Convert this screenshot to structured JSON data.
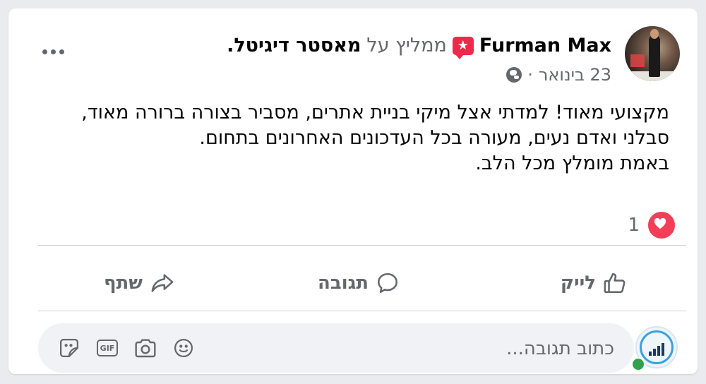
{
  "post": {
    "author_name": "Furman Max",
    "recommends_label": "ממליץ על",
    "page_name": "מאסטר דיגיטל",
    "trailing_period": ".",
    "date": "23 בינואר",
    "separator": "·",
    "body_lines": [
      "מקצועי מאוד! למדתי אצל מיקי בניית אתרים, מסביר בצורה ברורה מאוד,",
      "סבלני ואדם נעים, מעורה בכל העדכונים האחרונים בתחום.",
      "באמת מומלץ מכל הלב."
    ],
    "reaction_count": "1"
  },
  "actions": {
    "like_label": "לייק",
    "comment_label": "תגובה",
    "share_label": "שתף"
  },
  "comment_box": {
    "placeholder": "כתוב תגובה...",
    "gif_label": "GIF"
  },
  "icons": {
    "recommend": "recommend-star-icon",
    "privacy": "globe-icon",
    "more": "more-options-icon",
    "reaction": "heart-reaction-icon",
    "like": "thumbs-up-icon",
    "comment": "speech-bubble-icon",
    "share": "share-arrow-icon",
    "emoji": "emoji-icon",
    "camera": "camera-icon",
    "gif": "gif-icon",
    "sticker": "sticker-icon"
  },
  "colors": {
    "reaction_red": "#f33e58",
    "recommend_red": "#f02849",
    "secondary_text": "#65676b",
    "online_green": "#31a24c"
  }
}
